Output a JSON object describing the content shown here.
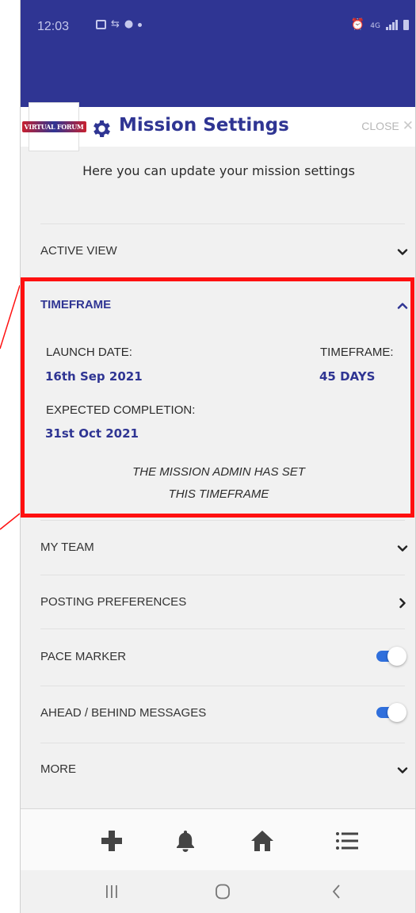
{
  "status_bar": {
    "time": "12:03",
    "network": "4G",
    "icons": [
      "gallery-icon",
      "wifi-sync-icon",
      "chat-icon",
      "dot-icon",
      "alarm-icon",
      "signal-icon",
      "battery-icon"
    ]
  },
  "header": {
    "logo_text": "VIRTUAL FORUM",
    "title": "Mission Settings",
    "close_label": "CLOSE"
  },
  "intro_text": "Here you can update your mission settings",
  "sections": {
    "active_view": "ACTIVE VIEW",
    "timeframe": "TIMEFRAME",
    "my_team": "MY TEAM",
    "posting_preferences": "POSTING PREFERENCES",
    "pace_marker": "PACE MARKER",
    "ahead_behind": "AHEAD / BEHIND MESSAGES",
    "more": "MORE"
  },
  "timeframe": {
    "launch_label": "LAUNCH DATE:",
    "launch_value": "16th Sep 2021",
    "timeframe_label": "TIMEFRAME:",
    "timeframe_value": "45 DAYS",
    "completion_label": "EXPECTED COMPLETION:",
    "completion_value": "31st Oct 2021",
    "admin_note_line1": "THE MISSION ADMIN HAS SET",
    "admin_note_line2": "THIS TIMEFRAME"
  },
  "toggles": {
    "pace_marker": true,
    "ahead_behind": true
  },
  "bottom_nav": [
    "add-icon",
    "bell-icon",
    "home-icon",
    "list-icon"
  ],
  "system_nav": [
    "recent-apps-icon",
    "home-circle-icon",
    "back-icon"
  ],
  "colors": {
    "brand_blue": "#2f3593",
    "toggle_blue": "#2f6fdc",
    "highlight_red": "#ff1010"
  }
}
